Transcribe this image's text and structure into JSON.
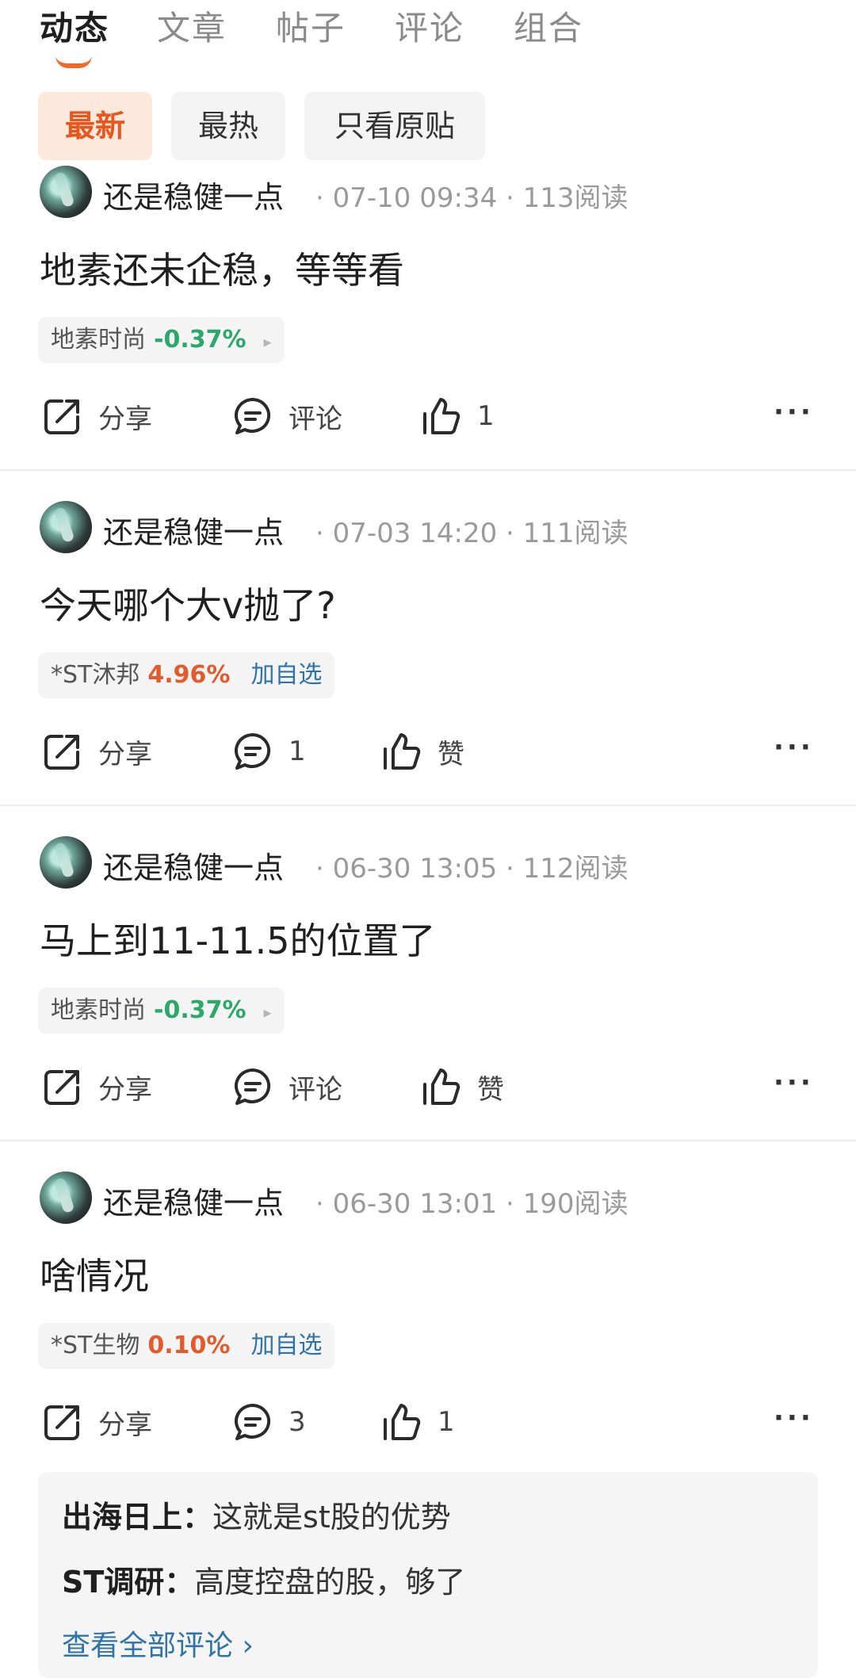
{
  "tabs": [
    "动态",
    "文章",
    "帖子",
    "评论",
    "组合"
  ],
  "filters": [
    "最新",
    "最热",
    "只看原贴"
  ],
  "actions": {
    "share": "分享",
    "comment": "评论",
    "more": "···"
  },
  "posts": [
    {
      "author": "还是稳健一点",
      "time": "07-10 09:34",
      "reads": "113阅读",
      "content": "地素还未企稳，等等看",
      "stock_name": "地素时尚",
      "stock_change": "-0.37%",
      "stock_trend": "down",
      "stock_action": "▸",
      "comment_label": "评论",
      "like_label": "1"
    },
    {
      "author": "还是稳健一点",
      "time": "07-03 14:20",
      "reads": "111阅读",
      "content": "今天哪个大v抛了?",
      "stock_name": "*ST沐邦",
      "stock_change": "4.96%",
      "stock_trend": "up",
      "stock_action": "加自选",
      "comment_label": "1",
      "like_label": "赞"
    },
    {
      "author": "还是稳健一点",
      "time": "06-30 13:05",
      "reads": "112阅读",
      "content": "马上到11-11.5的位置了",
      "stock_name": "地素时尚",
      "stock_change": "-0.37%",
      "stock_trend": "down",
      "stock_action": "▸",
      "comment_label": "评论",
      "like_label": "赞"
    },
    {
      "author": "还是稳健一点",
      "time": "06-30 13:01",
      "reads": "190阅读",
      "content": "啥情况",
      "stock_name": "*ST生物",
      "stock_change": "0.10%",
      "stock_trend": "up",
      "stock_action": "加自选",
      "comment_label": "3",
      "like_label": "1"
    }
  ],
  "comments": [
    {
      "user": "出海日上：",
      "text": "这就是st股的优势"
    },
    {
      "user": "ST调研：",
      "text": "高度控盘的股，够了"
    }
  ],
  "view_all": "查看全部评论 ›",
  "colors": {
    "accent": "#f06a2a",
    "down": "#2ea76a",
    "up": "#e35a2b",
    "link": "#2f74a8"
  }
}
